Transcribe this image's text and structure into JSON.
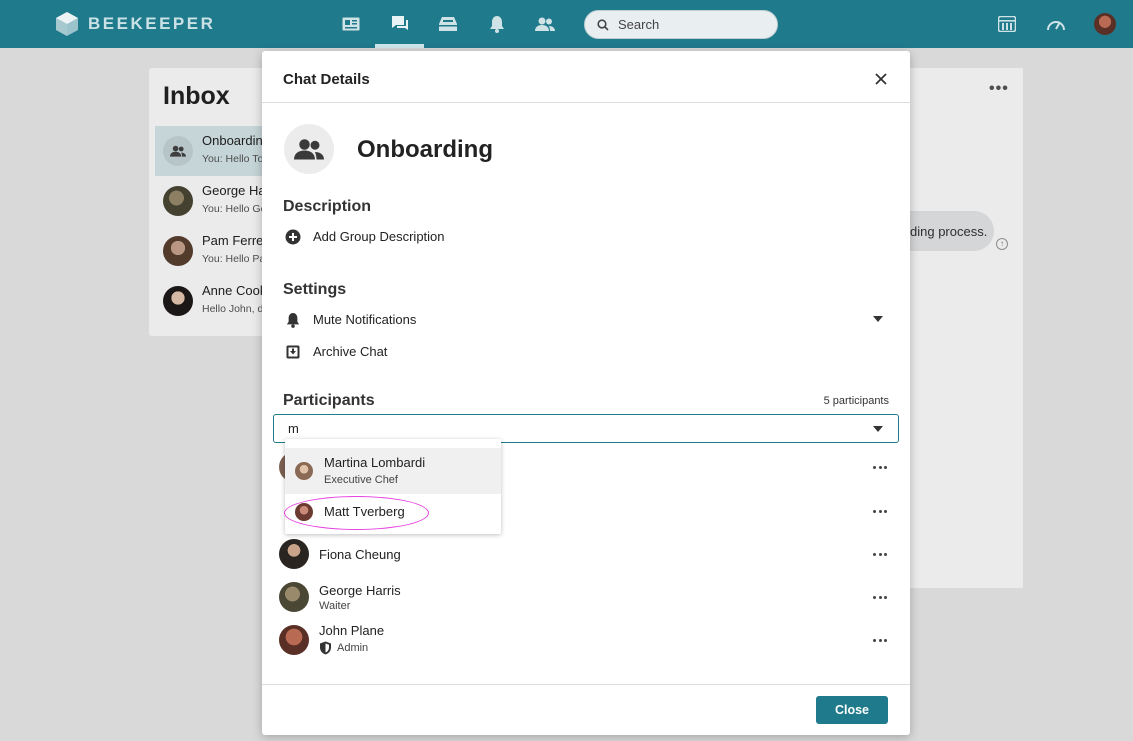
{
  "app": {
    "brand": "BEEKEEPER",
    "accent": "#1f7a8c"
  },
  "topnav": {
    "icons": [
      "news-icon",
      "chat-icon",
      "inbox-icon",
      "notifications-icon",
      "people-icon"
    ],
    "active": "chat-icon",
    "search_placeholder": "Search",
    "right_icons": [
      "apps-icon",
      "dashboard-icon",
      "user-avatar"
    ]
  },
  "inbox": {
    "title": "Inbox",
    "items": [
      {
        "name": "Onboardin",
        "preview": "You: Hello To"
      },
      {
        "name": "George Ha",
        "preview": "You: Hello Ge"
      },
      {
        "name": "Pam Ferrer",
        "preview": "You: Hello Pa"
      },
      {
        "name": "Anne Cook",
        "preview": "Hello John, d"
      }
    ]
  },
  "chat_background": {
    "bubble_text": "ding process."
  },
  "modal": {
    "title": "Chat Details",
    "group_name": "Onboarding",
    "description": {
      "heading": "Description",
      "add_label": "Add Group Description"
    },
    "settings": {
      "heading": "Settings",
      "mute_label": "Mute Notifications",
      "archive_label": "Archive Chat"
    },
    "participants": {
      "heading": "Participants",
      "count_label": "5 participants",
      "search_value": "m",
      "suggestions": [
        {
          "name": "Martina Lombardi",
          "role": "Executive Chef"
        },
        {
          "name": "Matt Tverberg",
          "role": ""
        }
      ],
      "list": [
        {
          "name": "Fiona Cheung",
          "role": ""
        },
        {
          "name": "George Harris",
          "role": "Waiter"
        },
        {
          "name": "John Plane",
          "role": "Admin"
        }
      ]
    },
    "close_button": "Close"
  }
}
